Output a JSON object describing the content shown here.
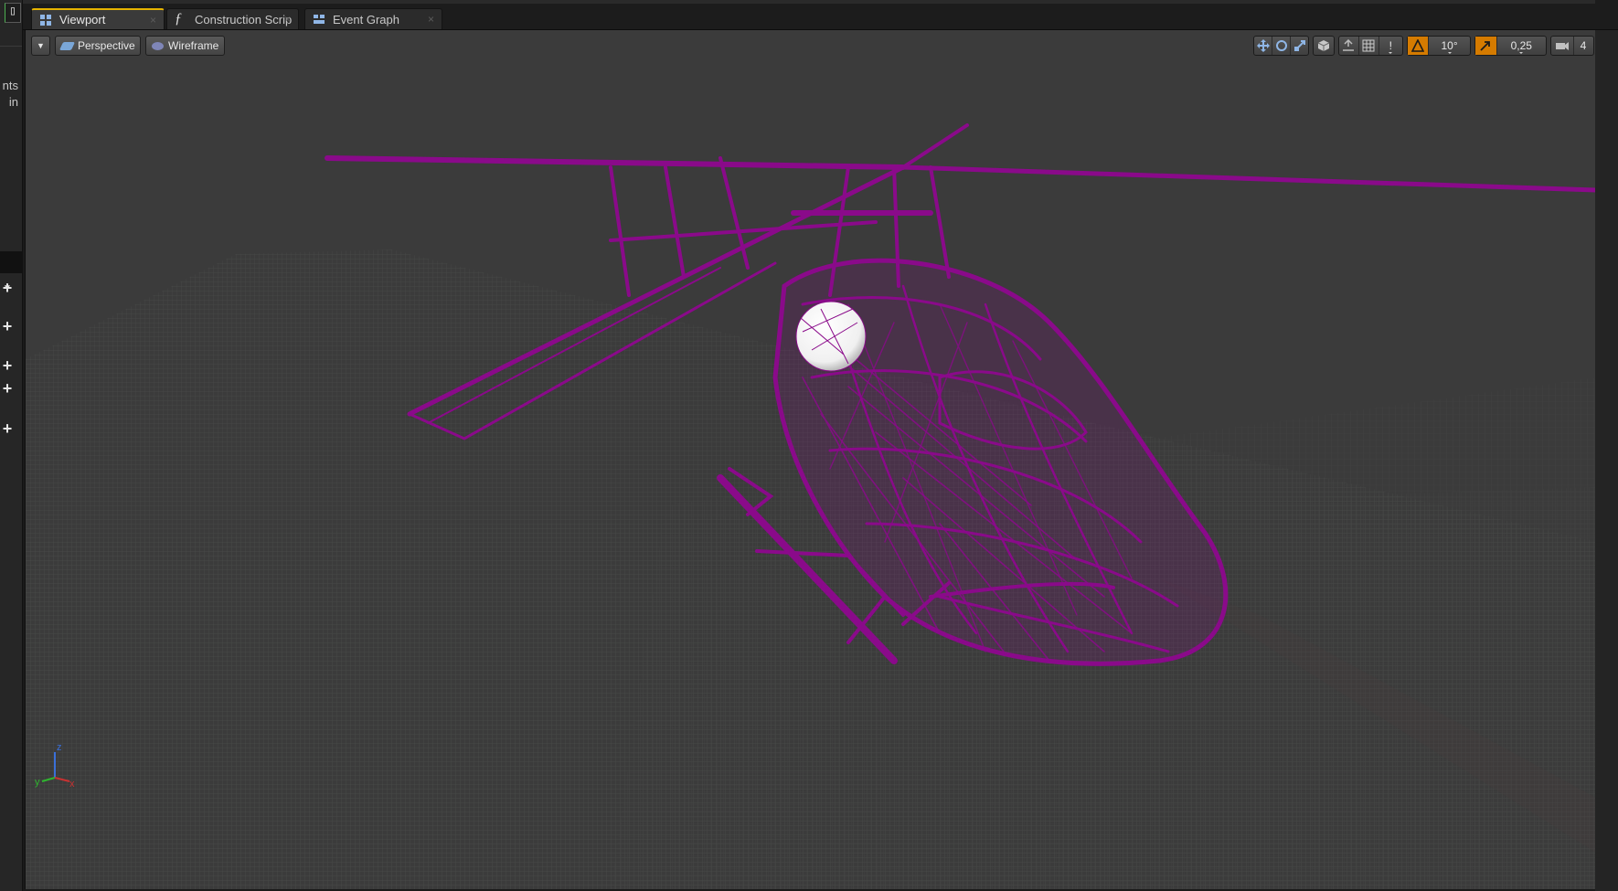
{
  "left_panel": {
    "edge_text_1": "nts",
    "edge_text_2": "in",
    "plus_count": 5
  },
  "tabs": [
    {
      "label": "Viewport",
      "icon": "viewport-grid-icon",
      "active": true
    },
    {
      "label": "Construction Scrip",
      "icon": "function-icon",
      "active": false
    },
    {
      "label": "Event Graph",
      "icon": "event-graph-icon",
      "active": false
    }
  ],
  "viewport_toolbar": {
    "menu_icon": "dropdown-arrow-icon",
    "perspective_label": "Perspective",
    "wireframe_label": "Wireframe",
    "transform_icons": [
      "translate-icon",
      "rotate-icon",
      "scale-icon"
    ],
    "coord_icon": "cube-world-icon",
    "surface_snap_icon": "surface-snap-icon",
    "grid_snap_icon": "grid-icon",
    "grid_snap_value": "!",
    "rotation_snap_icon": "rotation-snap-icon",
    "rotation_snap_value": "10°",
    "scale_snap_icon": "scale-snap-icon",
    "scale_snap_value": "0,25",
    "camera_speed_icon": "camera-icon",
    "camera_speed_value": "4"
  },
  "colors": {
    "wireframe": "#8a0a8a",
    "viewport_bg": "#3b3b3b",
    "active_tab_accent": "#e6b400",
    "snap_orange": "#d57b00"
  },
  "axis_gizmo": {
    "x": "x",
    "y": "y",
    "z": "z"
  }
}
